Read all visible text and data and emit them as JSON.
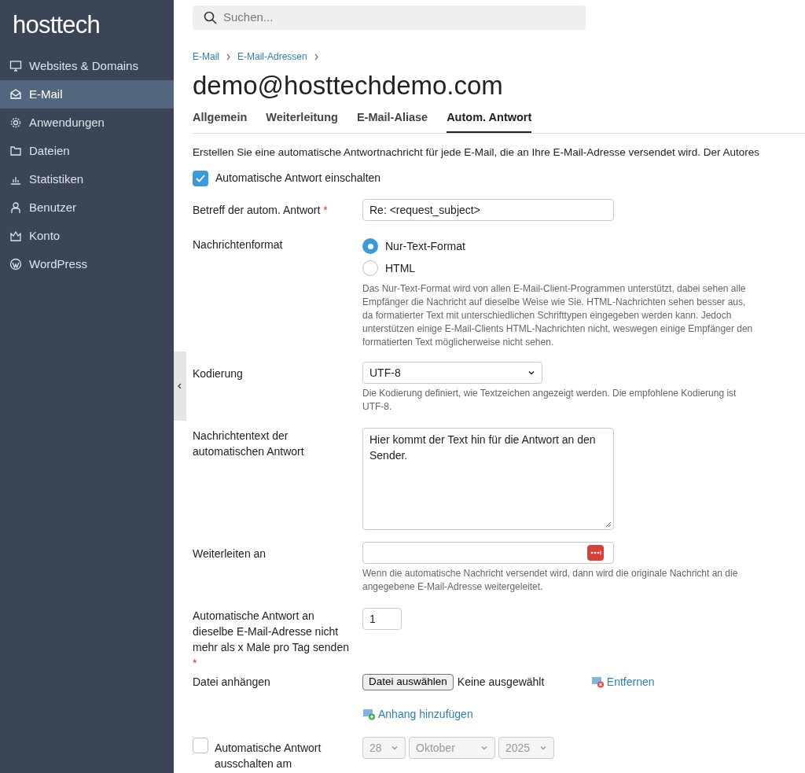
{
  "sidebar": {
    "logo": "hosttech",
    "items": [
      {
        "label": "Websites & Domains",
        "selected": false
      },
      {
        "label": "E-Mail",
        "selected": true
      },
      {
        "label": "Anwendungen",
        "selected": false
      },
      {
        "label": "Dateien",
        "selected": false
      },
      {
        "label": "Statistiken",
        "selected": false
      },
      {
        "label": "Benutzer",
        "selected": false
      },
      {
        "label": "Konto",
        "selected": false
      },
      {
        "label": "WordPress",
        "selected": false
      }
    ]
  },
  "search": {
    "placeholder": "Suchen..."
  },
  "breadcrumbs": [
    "E-Mail",
    "E-Mail-Adressen"
  ],
  "title": "demo@hosttechdemo.com",
  "tabs": [
    {
      "label": "Allgemein",
      "selected": false
    },
    {
      "label": "Weiterleitung",
      "selected": false
    },
    {
      "label": "E-Mail-Aliase",
      "selected": false
    },
    {
      "label": "Autom. Antwort",
      "selected": true
    }
  ],
  "intro": "Erstellen Sie eine automatische Antwortnachricht für jede E-Mail, die an Ihre E-Mail-Adresse versendet wird. Der Autores",
  "enable": {
    "label": "Automatische Antwort einschalten",
    "checked": true
  },
  "form": {
    "subject": {
      "label": "Betreff der autom. Antwort",
      "required_mark": "*",
      "value": "Re: <request_subject>"
    },
    "format": {
      "label": "Nachrichtenformat",
      "options": [
        {
          "label": "Nur-Text-Format",
          "selected": true
        },
        {
          "label": "HTML",
          "selected": false
        }
      ],
      "hint": "Das Nur-Text-Format wird von allen E-Mail-Client-Programmen unterstützt, dabei sehen alle Empfänger die Nachricht auf dieselbe Weise wie Sie. HTML-Nachrichten sehen besser aus, da formatierter Text mit unterschiedlichen Schrifttypen eingegeben werden kann. Jedoch unterstützen einige E-Mail-Clients HTML-Nachrichten nicht, weswegen einige Empfänger den formatierten Text möglicherweise nicht sehen."
    },
    "encoding": {
      "label": "Kodierung",
      "value": "UTF-8",
      "hint": "Die Kodierung definiert, wie Textzeichen angezeigt werden. Die empfohlene Kodierung ist UTF-8."
    },
    "body": {
      "label": "Nachrichtentext der automatischen Antwort",
      "value": "Hier kommt der Text hin für die Antwort an den Sender."
    },
    "forward": {
      "label": "Weiterleiten an",
      "hint": "Wenn die automatische Nachricht versendet wird, dann wird die originale Nachricht an die angegebene E-Mail-Adresse weitergeleitet."
    },
    "limit": {
      "label": "Automatische Antwort an dieselbe E-Mail-Adresse nicht mehr als x Male pro Tag senden",
      "required_mark": "*",
      "value": "1"
    },
    "attach": {
      "label": "Datei anhängen",
      "button": "Datei auswählen",
      "status": "Keine ausgewählt",
      "remove": "Entfernen",
      "add": "Anhang hinzufügen"
    },
    "disable": {
      "label": "Automatische Antwort ausschalten am",
      "checked": false,
      "day": "28",
      "month": "Oktober",
      "year": "2025",
      "disabled": true
    }
  }
}
